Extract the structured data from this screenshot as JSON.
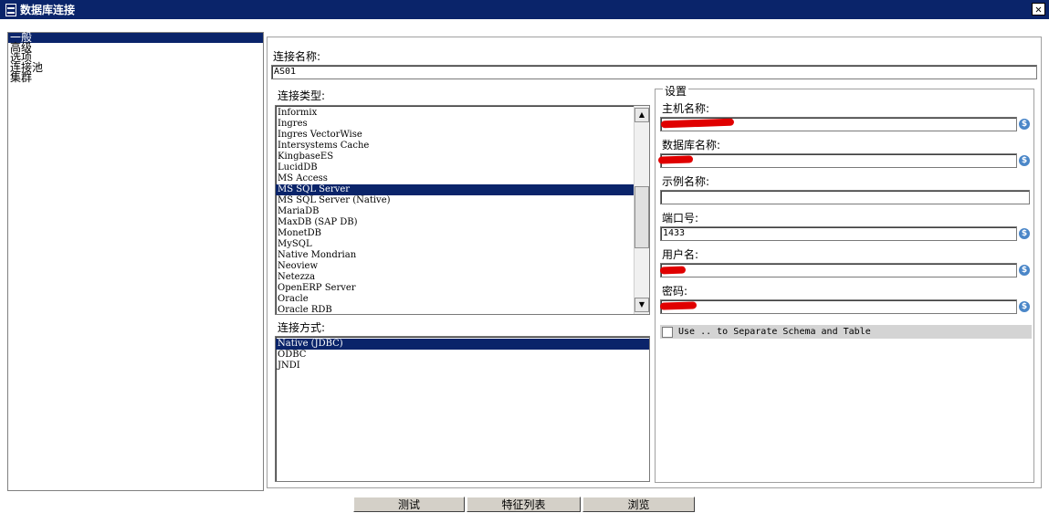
{
  "window": {
    "title": "数据库连接",
    "close_glyph": "✕"
  },
  "nav": {
    "items": [
      {
        "label": "一般",
        "selected": true
      },
      {
        "label": "高级",
        "selected": false
      },
      {
        "label": "选项",
        "selected": false
      },
      {
        "label": "连接池",
        "selected": false
      },
      {
        "label": "集群",
        "selected": false
      }
    ]
  },
  "connection_name": {
    "label": "连接名称:",
    "value": "AS01"
  },
  "connection_type": {
    "label": "连接类型:",
    "items": [
      "Informix",
      "Ingres",
      "Ingres VectorWise",
      "Intersystems Cache",
      "KingbaseES",
      "LucidDB",
      "MS Access",
      "MS SQL Server",
      "MS SQL Server (Native)",
      "MariaDB",
      "MaxDB (SAP DB)",
      "MonetDB",
      "MySQL",
      "Native Mondrian",
      "Neoview",
      "Netezza",
      "OpenERP Server",
      "Oracle",
      "Oracle RDB"
    ],
    "selected": "MS SQL Server"
  },
  "access_method": {
    "label": "连接方式:",
    "items": [
      "Native (JDBC)",
      "ODBC",
      "JNDI"
    ],
    "selected": "Native (JDBC)"
  },
  "settings": {
    "title": "设置",
    "host_label": "主机名称:",
    "host_value": "",
    "db_label": "数据库名称:",
    "db_value": "",
    "instance_label": "示例名称:",
    "instance_value": "",
    "port_label": "端口号:",
    "port_value": "1433",
    "user_label": "用户名:",
    "user_value": "",
    "password_label": "密码:",
    "password_value": "",
    "var_icon": "$",
    "checkbox_label": "Use .. to Separate Schema and Table"
  },
  "buttons": {
    "test": "测试",
    "feature_list": "特征列表",
    "explore": "浏览"
  },
  "colors": {
    "title_bar": "#0a246a",
    "selection": "#0a246a",
    "redaction": "#e00000",
    "variable_icon": "#4a86c8"
  }
}
